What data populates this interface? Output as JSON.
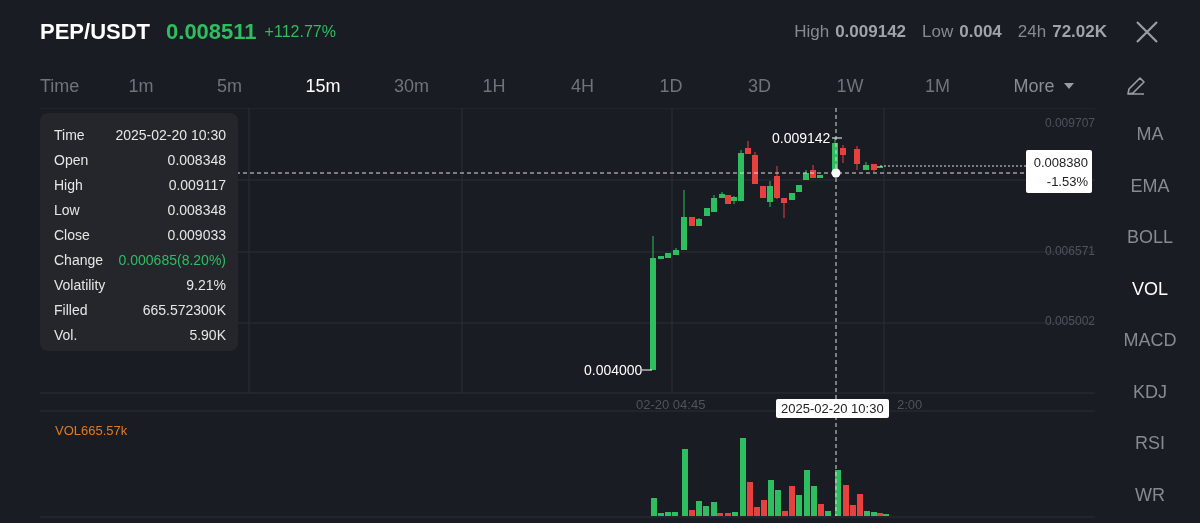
{
  "header": {
    "pair": "PEP/USDT",
    "price": "0.008511",
    "change": "+112.77%",
    "stats": [
      {
        "label": "High",
        "value": "0.009142"
      },
      {
        "label": "Low",
        "value": "0.004"
      },
      {
        "label": "24h",
        "value": "72.02K"
      }
    ]
  },
  "intervals": [
    {
      "label": "Time",
      "selected": false
    },
    {
      "label": "1m",
      "selected": false
    },
    {
      "label": "5m",
      "selected": false
    },
    {
      "label": "15m",
      "selected": true
    },
    {
      "label": "30m",
      "selected": false
    },
    {
      "label": "1H",
      "selected": false
    },
    {
      "label": "4H",
      "selected": false
    },
    {
      "label": "1D",
      "selected": false
    },
    {
      "label": "3D",
      "selected": false
    },
    {
      "label": "1W",
      "selected": false
    },
    {
      "label": "1M",
      "selected": false
    }
  ],
  "more": {
    "label": "More"
  },
  "indicators": [
    {
      "label": "MA",
      "selected": false
    },
    {
      "label": "EMA",
      "selected": false
    },
    {
      "label": "BOLL",
      "selected": false
    },
    {
      "label": "VOL",
      "selected": true
    },
    {
      "label": "MACD",
      "selected": false
    },
    {
      "label": "KDJ",
      "selected": false
    },
    {
      "label": "RSI",
      "selected": false
    },
    {
      "label": "WR",
      "selected": false
    }
  ],
  "ohlc_panel": [
    {
      "label": "Time",
      "value": "2025-02-20 10:30",
      "kind": "plain"
    },
    {
      "label": "Open",
      "value": "0.008348",
      "kind": "plain"
    },
    {
      "label": "High",
      "value": "0.009117",
      "kind": "plain"
    },
    {
      "label": "Low",
      "value": "0.008348",
      "kind": "plain"
    },
    {
      "label": "Close",
      "value": "0.009033",
      "kind": "plain"
    },
    {
      "label": "Change",
      "value": "0.000685(8.20%)",
      "kind": "up"
    },
    {
      "label": "Volatility",
      "value": "9.21%",
      "kind": "plain"
    },
    {
      "label": "Filled",
      "value": "665.572300K",
      "kind": "plain"
    },
    {
      "label": "Vol.",
      "value": "5.90K",
      "kind": "plain"
    }
  ],
  "chart": {
    "price_axis": [
      "0.009707",
      "0.006571",
      "0.005002"
    ],
    "high_marker": "0.009142",
    "low_marker": "0.004000",
    "last_price": "0.008380",
    "last_change": "-1.53%",
    "time_axis": [
      "02-20 04:45",
      "2:00"
    ],
    "crosshair_time": "2025-02-20 10:30"
  },
  "volume": {
    "label": "VOL665.57k"
  }
}
